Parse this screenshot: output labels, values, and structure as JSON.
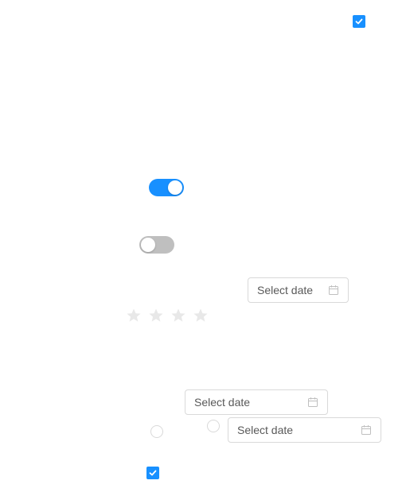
{
  "controls": {
    "checkbox_top": {
      "checked": true
    },
    "switch_on": {
      "state": "on"
    },
    "switch_off": {
      "state": "off"
    },
    "datepicker_1": {
      "placeholder": "Select date"
    },
    "datepicker_2": {
      "placeholder": "Select date"
    },
    "datepicker_3": {
      "placeholder": "Select date"
    },
    "rating": {
      "stars_total": 4,
      "stars_filled": 0
    },
    "radio_left": {
      "checked": false
    },
    "radio_right": {
      "checked": false
    },
    "checkbox_bottom": {
      "checked": true
    }
  },
  "colors": {
    "accent": "#1890ff",
    "switch_off": "#bfbfbf",
    "border": "#d9d9d9",
    "star_empty": "#e8e8e8",
    "placeholder_text": "#595959"
  },
  "icons": {
    "checkmark": "check-icon",
    "calendar": "calendar-icon",
    "star": "star-icon"
  }
}
